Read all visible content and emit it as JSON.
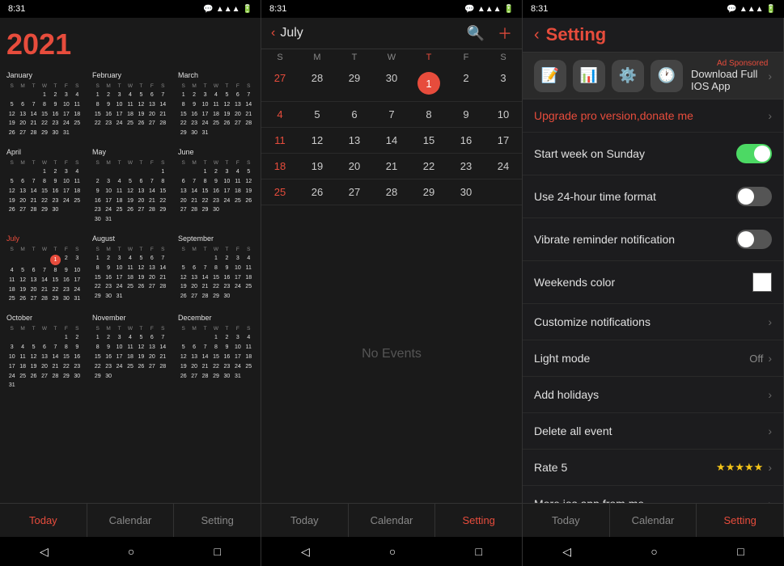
{
  "statusBar": {
    "time": "8:31",
    "icons": "📶🔋"
  },
  "panels": {
    "left": {
      "year": "2021",
      "months": [
        {
          "name": "January",
          "days": [
            "",
            "",
            "",
            "1",
            "2",
            "3",
            "4",
            "5",
            "6",
            "7",
            "8",
            "9",
            "10",
            "11",
            "12",
            "13",
            "14",
            "15",
            "16",
            "17",
            "18",
            "19",
            "20",
            "21",
            "22",
            "23",
            "24",
            "25",
            "26",
            "27",
            "28",
            "29",
            "30",
            "31"
          ]
        },
        {
          "name": "February",
          "days": [
            "1",
            "2",
            "3",
            "4",
            "5",
            "6",
            "7",
            "8",
            "9",
            "10",
            "11",
            "12",
            "13",
            "14",
            "15",
            "16",
            "17",
            "18",
            "19",
            "20",
            "21",
            "22",
            "23",
            "24",
            "25",
            "26",
            "27",
            "28"
          ]
        },
        {
          "name": "March",
          "days": [
            "1",
            "2",
            "3",
            "4",
            "5",
            "6",
            "7",
            "8",
            "9",
            "10",
            "11",
            "12",
            "13",
            "14",
            "15",
            "16",
            "17",
            "18",
            "19",
            "20",
            "21",
            "22",
            "23",
            "24",
            "25",
            "26",
            "27",
            "28",
            "29",
            "30",
            "31"
          ]
        },
        {
          "name": "April",
          "days": [
            "",
            "",
            "",
            "1",
            "2",
            "3",
            "4",
            "5",
            "6",
            "7",
            "8",
            "9",
            "10",
            "11",
            "12",
            "13",
            "14",
            "15",
            "16",
            "17",
            "18",
            "19",
            "20",
            "21",
            "22",
            "23",
            "24",
            "25",
            "26",
            "27",
            "28",
            "29",
            "30"
          ]
        },
        {
          "name": "May",
          "days": [
            "",
            "",
            "",
            "",
            "",
            "",
            "1",
            "2",
            "3",
            "4",
            "5",
            "6",
            "7",
            "8",
            "9",
            "10",
            "11",
            "12",
            "13",
            "14",
            "15",
            "16",
            "17",
            "18",
            "19",
            "20",
            "21",
            "22",
            "23",
            "24",
            "25",
            "26",
            "27",
            "28",
            "29",
            "30",
            "31"
          ]
        },
        {
          "name": "June",
          "days": [
            "",
            "",
            "1",
            "2",
            "3",
            "4",
            "5",
            "6",
            "7",
            "8",
            "9",
            "10",
            "11",
            "12",
            "13",
            "14",
            "15",
            "16",
            "17",
            "18",
            "19",
            "20",
            "21",
            "22",
            "23",
            "24",
            "25",
            "26",
            "27",
            "28",
            "29",
            "30"
          ]
        },
        {
          "name": "July",
          "current": true,
          "days": [
            "",
            "",
            "",
            "",
            "1",
            "2",
            "3",
            "4",
            "5",
            "6",
            "7",
            "8",
            "9",
            "10",
            "11",
            "12",
            "13",
            "14",
            "15",
            "16",
            "17",
            "18",
            "19",
            "20",
            "21",
            "22",
            "23",
            "24",
            "25",
            "26",
            "27",
            "28",
            "29",
            "30",
            "31"
          ]
        },
        {
          "name": "August",
          "days": [
            "1",
            "2",
            "3",
            "4",
            "5",
            "6",
            "7",
            "8",
            "9",
            "10",
            "11",
            "12",
            "13",
            "14",
            "15",
            "16",
            "17",
            "18",
            "19",
            "20",
            "21",
            "22",
            "23",
            "24",
            "25",
            "26",
            "27",
            "28",
            "29",
            "30",
            "31"
          ]
        },
        {
          "name": "September",
          "days": [
            "",
            "",
            "",
            "1",
            "2",
            "3",
            "4",
            "5",
            "6",
            "7",
            "8",
            "9",
            "10",
            "11",
            "12",
            "13",
            "14",
            "15",
            "16",
            "17",
            "18",
            "19",
            "20",
            "21",
            "22",
            "23",
            "24",
            "25",
            "26",
            "27",
            "28",
            "29",
            "30"
          ]
        },
        {
          "name": "October",
          "days": [
            "",
            "",
            "",
            "",
            "",
            "1",
            "2",
            "3",
            "4",
            "5",
            "6",
            "7",
            "8",
            "9",
            "10",
            "11",
            "12",
            "13",
            "14",
            "15",
            "16",
            "17",
            "18",
            "19",
            "20",
            "21",
            "22",
            "23",
            "24",
            "25",
            "26",
            "27",
            "28",
            "29",
            "30",
            "31"
          ]
        },
        {
          "name": "November",
          "days": [
            "1",
            "2",
            "3",
            "4",
            "5",
            "6",
            "7",
            "8",
            "9",
            "10",
            "11",
            "12",
            "13",
            "14",
            "15",
            "16",
            "17",
            "18",
            "19",
            "20",
            "21",
            "22",
            "23",
            "24",
            "25",
            "26",
            "27",
            "28",
            "29",
            "30"
          ]
        },
        {
          "name": "December",
          "days": [
            "",
            "",
            "",
            "1",
            "2",
            "3",
            "4",
            "5",
            "6",
            "7",
            "8",
            "9",
            "10",
            "11",
            "12",
            "13",
            "14",
            "15",
            "16",
            "17",
            "18",
            "19",
            "20",
            "21",
            "22",
            "23",
            "24",
            "25",
            "26",
            "27",
            "28",
            "29",
            "30",
            "31"
          ]
        }
      ],
      "nav": [
        "Today",
        "Calendar",
        "Setting"
      ]
    },
    "middle": {
      "month": "July",
      "dows": [
        "S",
        "M",
        "T",
        "W",
        "T",
        "F",
        "S"
      ],
      "weeks": [
        [
          "27",
          "28",
          "29",
          "30",
          "1",
          "2",
          "3"
        ],
        [
          "4",
          "5",
          "6",
          "7",
          "8",
          "9",
          "10"
        ],
        [
          "11",
          "12",
          "13",
          "14",
          "15",
          "16",
          "17"
        ],
        [
          "18",
          "19",
          "20",
          "21",
          "22",
          "23",
          "24"
        ],
        [
          "25",
          "26",
          "27",
          "28",
          "29",
          "30",
          ""
        ]
      ],
      "today_day": "1",
      "no_events": "No Events",
      "nav": [
        "Today",
        "Calendar",
        "Setting"
      ]
    },
    "right": {
      "title": "Setting",
      "ad_label": "Ad Sponsored",
      "ad_text": "Download Full IOS App",
      "upgrade_text": "Upgrade pro version,donate me",
      "items": [
        {
          "label": "Start week on Sunday",
          "type": "toggle",
          "state": "on"
        },
        {
          "label": "Use 24-hour time format",
          "type": "toggle",
          "state": "off"
        },
        {
          "label": "Vibrate reminder notification",
          "type": "toggle",
          "state": "off"
        },
        {
          "label": "Weekends color",
          "type": "color",
          "color": "#ffffff"
        },
        {
          "label": "Customize notifications",
          "type": "chevron"
        },
        {
          "label": "Light mode",
          "type": "off_chevron",
          "value": "Off"
        },
        {
          "label": "Add holidays",
          "type": "chevron"
        },
        {
          "label": "Delete all event",
          "type": "chevron"
        },
        {
          "label": "Rate 5",
          "type": "stars",
          "stars": "★★★★★"
        },
        {
          "label": "More ios app from me",
          "type": "chevron"
        }
      ],
      "nav": [
        "Today",
        "Calendar",
        "Setting"
      ]
    }
  }
}
